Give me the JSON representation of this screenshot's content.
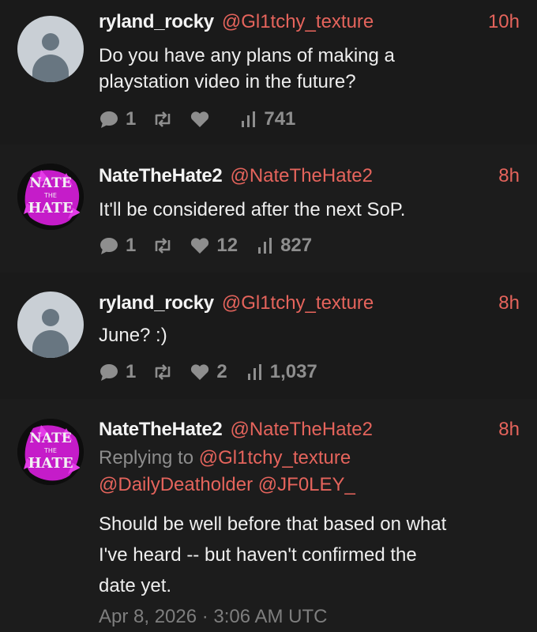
{
  "colors": {
    "accent": "#e5645c",
    "thread_line": "#7a3a36",
    "background": "#1a1a1a"
  },
  "tweets": [
    {
      "author": "ryland_rocky",
      "handle": "@Gl1tchy_texture",
      "time": "10h",
      "text_lines": [
        "Do you have any plans of making a",
        "playstation video in the future?"
      ],
      "replies": "1",
      "retweets": "",
      "likes": "",
      "views": "741",
      "avatar": "default-avatar-icon"
    },
    {
      "author": "NateTheHate2",
      "handle": "@NateTheHate2",
      "time": "8h",
      "text_lines": [
        "It'll be considered after the next SoP."
      ],
      "replies": "1",
      "retweets": "",
      "likes": "12",
      "views": "827",
      "avatar": "nate-the-hate-logo",
      "avatar_text": {
        "top": "NATE",
        "middle": "THE",
        "bottom": "HATE"
      }
    },
    {
      "author": "ryland_rocky",
      "handle": "@Gl1tchy_texture",
      "time": "8h",
      "text_lines": [
        "June? :)"
      ],
      "replies": "1",
      "retweets": "",
      "likes": "2",
      "views": "1,037",
      "avatar": "default-avatar-icon"
    },
    {
      "author": "NateTheHate2",
      "handle": "@NateTheHate2",
      "time": "8h",
      "replying_prefix": "Replying to",
      "mentions": [
        "@Gl1tchy_texture",
        "@DailyDeatholder",
        "@JF0LEY_"
      ],
      "text_lines": [
        "Should be well before that based on what",
        "I've heard -- but haven't confirmed the",
        "date yet."
      ],
      "timestamp": "Apr 8, 2026 · 3:06 AM UTC",
      "avatar": "nate-the-hate-logo",
      "avatar_text": {
        "top": "NATE",
        "middle": "THE",
        "bottom": "HATE"
      }
    }
  ]
}
